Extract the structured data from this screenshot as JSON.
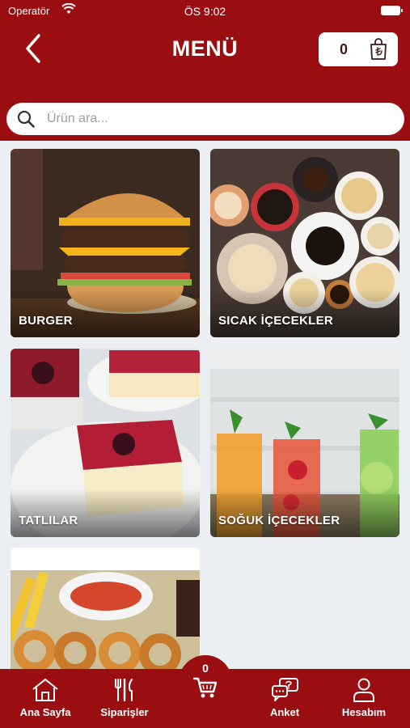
{
  "status_bar": {
    "carrier": "Operatör",
    "time": "ÖS 9:02"
  },
  "header": {
    "title": "MENÜ",
    "cart_count": "0"
  },
  "search": {
    "placeholder": "Ürün ara..."
  },
  "categories": [
    {
      "label": "BURGER"
    },
    {
      "label": "SICAK İÇECEKLER"
    },
    {
      "label": "TATLILAR"
    },
    {
      "label": "SOĞUK İÇECEKLER"
    },
    {
      "label": ""
    }
  ],
  "tabbar": {
    "home": "Ana Sayfa",
    "orders": "Siparişler",
    "cart_count": "0",
    "survey": "Anket",
    "account": "Hesabım"
  },
  "colors": {
    "brand": "#9a0e12",
    "background": "#ebeff3"
  }
}
